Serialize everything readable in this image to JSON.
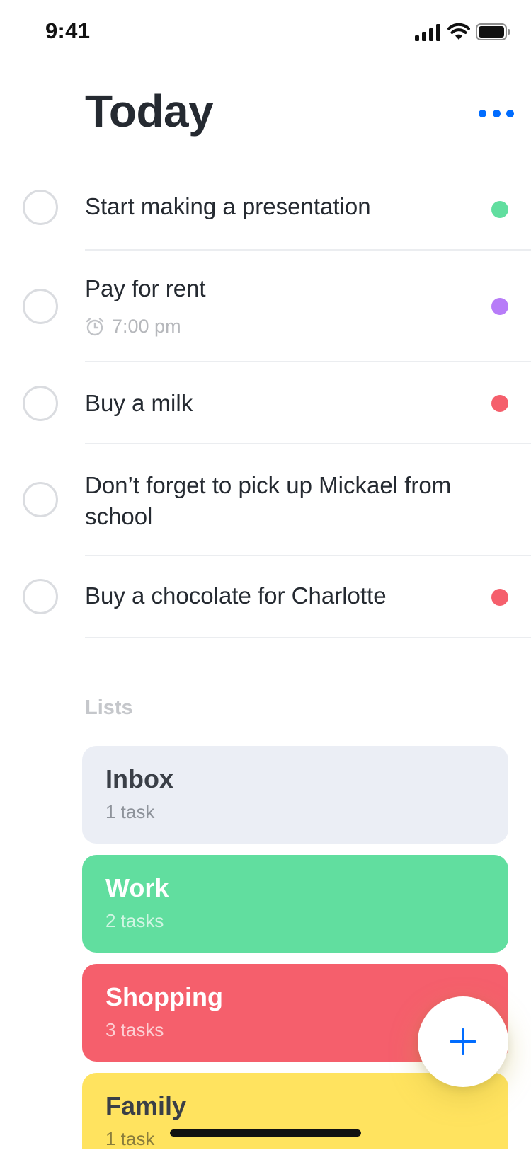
{
  "status_bar": {
    "time": "9:41"
  },
  "header": {
    "title": "Today"
  },
  "tasks": [
    {
      "title": "Start making a presentation",
      "color": "#61DE9F"
    },
    {
      "title": "Pay for rent",
      "time": "7:00 pm",
      "color": "#B77CF8"
    },
    {
      "title": "Buy a milk",
      "color": "#F55F6C"
    },
    {
      "title": "Don’t forget to pick up Mickael from school"
    },
    {
      "title": "Buy a chocolate for Charlotte",
      "color": "#F55F6C"
    }
  ],
  "lists_section": {
    "heading": "Lists",
    "items": [
      {
        "name": "Inbox",
        "count": "1 task",
        "bg": "#EBEEF5"
      },
      {
        "name": "Work",
        "count": "2 tasks",
        "bg": "#61DE9F"
      },
      {
        "name": "Shopping",
        "count": "3 tasks",
        "bg": "#F55F6C"
      },
      {
        "name": "Family",
        "count": "1 task",
        "bg": "#FFE35F"
      }
    ]
  },
  "icons": {
    "more": "more-dots-icon",
    "alarm": "alarm-clock-icon",
    "add": "plus-icon"
  },
  "colors": {
    "accent": "#006CFF"
  }
}
